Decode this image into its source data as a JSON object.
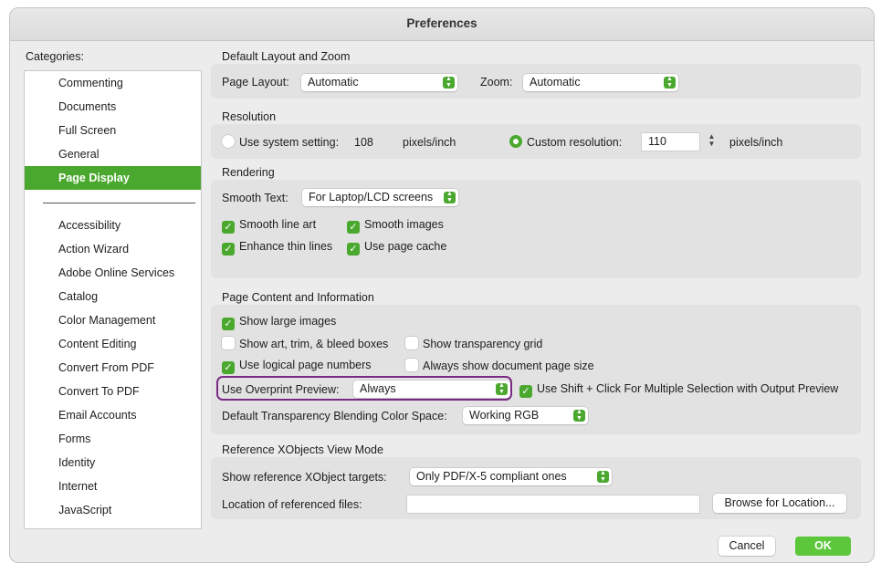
{
  "window": {
    "title": "Preferences"
  },
  "categories": {
    "label": "Categories:",
    "items_top": [
      "Commenting",
      "Documents",
      "Full Screen",
      "General",
      "Page Display"
    ],
    "selected": "Page Display",
    "items_bottom": [
      "Accessibility",
      "Action Wizard",
      "Adobe Online Services",
      "Catalog",
      "Color Management",
      "Content Editing",
      "Convert From PDF",
      "Convert To PDF",
      "Email Accounts",
      "Forms",
      "Identity",
      "Internet",
      "JavaScript"
    ]
  },
  "layout_zoom": {
    "title": "Default Layout and Zoom",
    "page_layout_label": "Page Layout:",
    "page_layout_value": "Automatic",
    "zoom_label": "Zoom:",
    "zoom_value": "Automatic"
  },
  "resolution": {
    "title": "Resolution",
    "system_label": "Use system setting:",
    "system_value": "108",
    "system_unit": "pixels/inch",
    "system_selected": false,
    "custom_label": "Custom resolution:",
    "custom_value": "110",
    "custom_unit": "pixels/inch",
    "custom_selected": true
  },
  "rendering": {
    "title": "Rendering",
    "smooth_text_label": "Smooth Text:",
    "smooth_text_value": "For Laptop/LCD screens",
    "smooth_line_art": {
      "label": "Smooth line art",
      "checked": true
    },
    "smooth_images": {
      "label": "Smooth images",
      "checked": true
    },
    "enhance_thin_lines": {
      "label": "Enhance thin lines",
      "checked": true
    },
    "use_page_cache": {
      "label": "Use page cache",
      "checked": true
    }
  },
  "page_content": {
    "title": "Page Content and Information",
    "show_large_images": {
      "label": "Show large images",
      "checked": true
    },
    "show_art_trim": {
      "label": "Show art, trim, & bleed boxes",
      "checked": false
    },
    "show_transparency_grid": {
      "label": "Show transparency grid",
      "checked": false
    },
    "use_logical_page_numbers": {
      "label": "Use logical page numbers",
      "checked": true
    },
    "always_show_doc_size": {
      "label": "Always show document page size",
      "checked": false
    },
    "overprint_label": "Use Overprint Preview:",
    "overprint_value": "Always",
    "shift_click": {
      "label": "Use Shift + Click For Multiple Selection with Output Preview",
      "checked": true
    },
    "blending_label": "Default Transparency Blending Color Space:",
    "blending_value": "Working RGB"
  },
  "xobjects": {
    "title": "Reference XObjects View Mode",
    "show_targets_label": "Show reference XObject targets:",
    "show_targets_value": "Only PDF/X-5 compliant ones",
    "location_label": "Location of referenced files:",
    "location_value": "",
    "browse_label": "Browse for Location..."
  },
  "footer": {
    "cancel_label": "Cancel",
    "ok_label": "OK"
  },
  "colors": {
    "accent": "#4ba82e",
    "ok_button": "#5cc73a",
    "highlight_border": "#7a2a84"
  }
}
